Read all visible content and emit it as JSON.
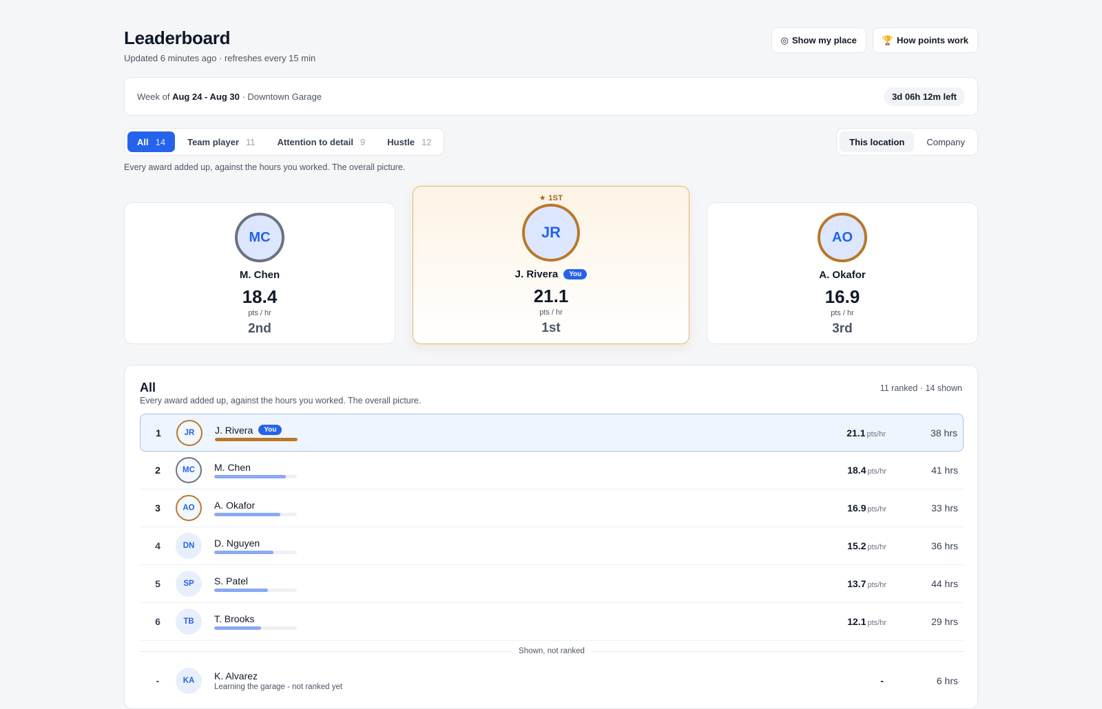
{
  "header": {
    "title": "Leaderboard",
    "subtitle": "Updated 6 minutes ago · refreshes every 15 min",
    "show_place_label": "Show my place",
    "show_place_icon": "◎",
    "points_label": "How points work",
    "points_icon": "🏆"
  },
  "week": {
    "prefix": "Week of",
    "range": "Aug 24 - Aug 30",
    "location": "· Downtown Garage",
    "time_left": "3d 06h 12m left"
  },
  "tabs": [
    {
      "label": "All",
      "count": "14"
    },
    {
      "label": "Team player",
      "count": "11"
    },
    {
      "label": "Attention to detail",
      "count": "9"
    },
    {
      "label": "Hustle",
      "count": "12"
    }
  ],
  "scope": {
    "this_location": "This location",
    "company": "Company"
  },
  "category_desc": "Every award added up, against the hours you worked. The overall picture.",
  "podium": {
    "first_tag": "★ 1ST",
    "unit": "pts / hr",
    "you_badge": "You",
    "second": {
      "initials": "MC",
      "name": "M. Chen",
      "score": "18.4",
      "rank": "2nd"
    },
    "first": {
      "initials": "JR",
      "name": "J. Rivera",
      "score": "21.1",
      "rank": "1st"
    },
    "third": {
      "initials": "AO",
      "name": "A. Okafor",
      "score": "16.9",
      "rank": "3rd"
    }
  },
  "board": {
    "title": "All",
    "desc": "Every award added up, against the hours you worked. The overall picture.",
    "meta": "11 ranked · 14 shown",
    "unit": "pts/hr",
    "you_badge": "You",
    "divider": "Shown, not ranked",
    "rows": [
      {
        "rank": "1",
        "initials": "JR",
        "name": "J. Rivera",
        "score": "21.1",
        "hrs": "38 hrs",
        "progress": 1.0
      },
      {
        "rank": "2",
        "initials": "MC",
        "name": "M. Chen",
        "score": "18.4",
        "hrs": "41 hrs",
        "progress": 0.87
      },
      {
        "rank": "3",
        "initials": "AO",
        "name": "A. Okafor",
        "score": "16.9",
        "hrs": "33 hrs",
        "progress": 0.8
      },
      {
        "rank": "4",
        "initials": "DN",
        "name": "D. Nguyen",
        "score": "15.2",
        "hrs": "36 hrs",
        "progress": 0.72
      },
      {
        "rank": "5",
        "initials": "SP",
        "name": "S. Patel",
        "score": "13.7",
        "hrs": "44 hrs",
        "progress": 0.65
      },
      {
        "rank": "6",
        "initials": "TB",
        "name": "T. Brooks",
        "score": "12.1",
        "hrs": "29 hrs",
        "progress": 0.57
      }
    ],
    "unranked": [
      {
        "rank": "-",
        "initials": "KA",
        "name": "K. Alvarez",
        "note": "Learning the garage - not ranked yet",
        "score": "-",
        "hrs": "6 hrs"
      }
    ]
  }
}
